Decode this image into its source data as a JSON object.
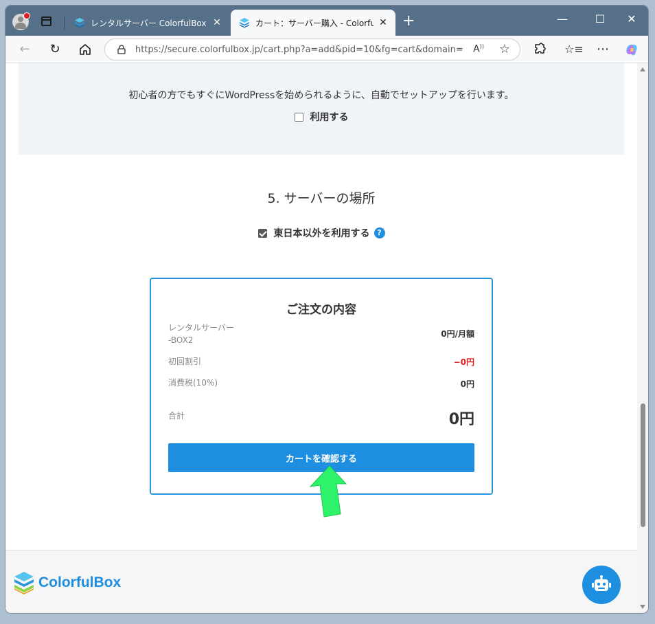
{
  "browser": {
    "tabs": [
      {
        "title": "レンタルサーバー ColorfulBox（カラフルボックス）",
        "active": false
      },
      {
        "title": "カート：サーバー購入 - ColorfulBox",
        "active": true
      }
    ],
    "url": "https://secure.colorfulbox.jp/cart.php?a=add&pid=10&fg=cart&domain=",
    "close_glyph": "✕",
    "new_tab_glyph": "+",
    "minimize_glyph": "—",
    "maximize_glyph": "☐",
    "window_close_glyph": "✕"
  },
  "wordpress_section": {
    "description": "初心者の方でもすぐにWordPressを始められるように、自動でセットアップを行います。",
    "checkbox_label": "利用する",
    "checked": false
  },
  "server_location": {
    "title": "5. サーバーの場所",
    "checkbox_label": "東日本以外を利用する",
    "checked": true,
    "help_glyph": "?"
  },
  "order": {
    "title": "ご注文の内容",
    "item_label_line1": "レンタルサーバー",
    "item_label_line2": "-BOX2",
    "item_value": "0円/月額",
    "discount_label": "初回割引",
    "discount_value": "−0円",
    "tax_label": "消費税(10%)",
    "tax_value": "0円",
    "total_label": "合計",
    "total_value": "0円",
    "button_label": "カートを確認する"
  },
  "footer": {
    "logo_text": "ColorfulBox"
  },
  "colors": {
    "brand": "#1e8ee0",
    "discount": "#e0201e",
    "arrow": "#2ef26a"
  }
}
